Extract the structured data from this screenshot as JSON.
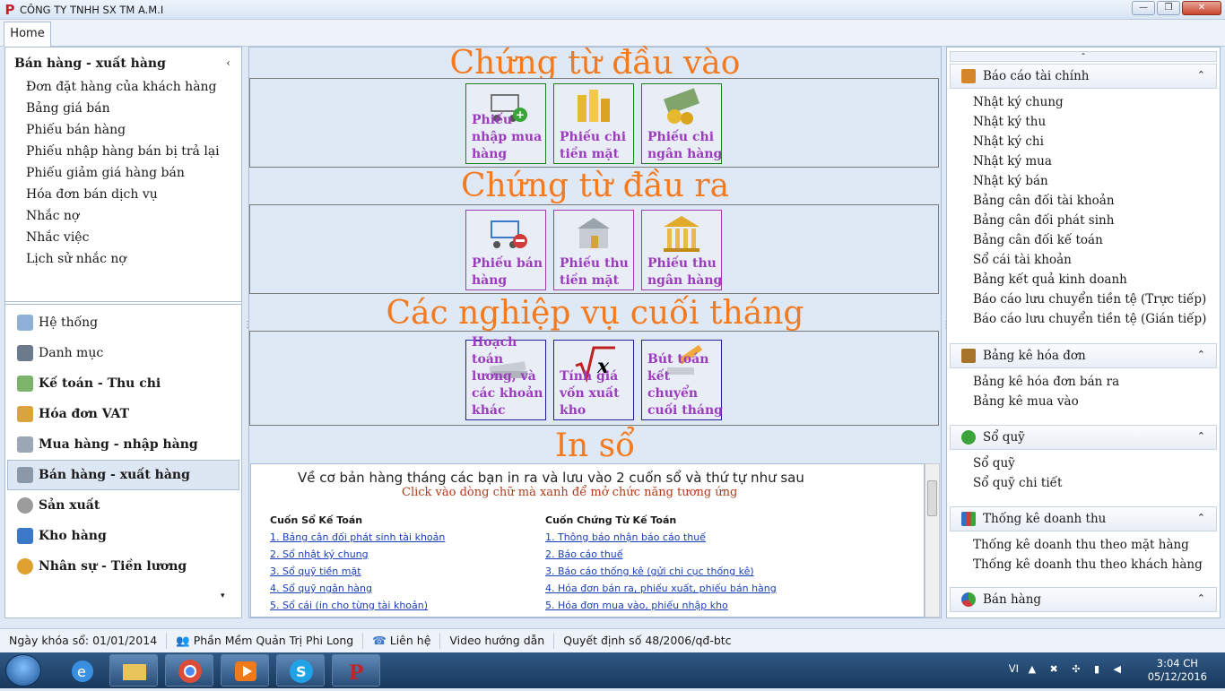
{
  "window": {
    "title": "CÔNG TY TNHH SX TM A.M.I",
    "logo_letter": "P"
  },
  "ribbon": {
    "tab_home": "Home"
  },
  "left": {
    "group_title": "Bán hàng - xuất hàng",
    "collapse_glyph": "‹",
    "items": [
      "Đơn đặt hàng của khách hàng",
      "Bảng giá bán",
      "Phiếu bán hàng",
      "Phiếu nhập hàng bán bị trả lại",
      "Phiếu giảm giá hàng bán",
      "Hóa đơn bán dịch vụ",
      "Nhắc nợ",
      "Nhắc việc",
      "Lịch sử nhắc nợ"
    ],
    "navs": [
      "Hệ thống",
      "Danh mục",
      "Kế toán - Thu chi",
      "Hóa đơn VAT",
      "Mua hàng - nhập hàng",
      "Bán hàng - xuất hàng",
      "Sản xuất",
      "Kho hàng",
      "Nhân sự - Tiền lương"
    ],
    "scroll_glyph": "▾"
  },
  "center": {
    "s1_title": "Chứng từ đầu vào",
    "s1_tiles": [
      "Phiếu nhập mua hàng",
      "Phiếu chi tiền mặt",
      "Phiếu chi ngân hàng"
    ],
    "s2_title": "Chứng từ đầu ra",
    "s2_tiles": [
      "Phiếu bán hàng",
      "Phiếu thu tiền mặt",
      "Phiếu thu ngân hàng"
    ],
    "s3_title": "Các nghiệp vụ cuối tháng",
    "s3_tiles": [
      "Hoạch toán lương, và các khoản khác",
      "Tính giá vốn xuất kho",
      "Bút toán kết chuyển cuối tháng"
    ],
    "s4_title": "In sổ",
    "inso_line1": "Về cơ bản hàng tháng các bạn in ra và lưu vào 2 cuốn sổ và thứ tự như sau",
    "inso_line2": "Click vào dòng chữ mà xanh để mở chức năng tương ứng",
    "col1_header": "Cuốn Sổ Kế Toán",
    "col1_links": [
      "1. Bảng cân đối phát sinh tài khoản",
      "2. Sổ nhật ký chung",
      "3. Sổ quỹ tiền mặt",
      "4. Sổ quỹ ngân hàng",
      "5. Sổ cái (in cho từng tài khoản)"
    ],
    "col2_header": "Cuốn Chứng Từ Kế Toán",
    "col2_links": [
      "1. Thông báo nhận báo cáo thuế",
      "2. Báo cáo thuế",
      "3. Báo cáo thống kê (gửi chi cục thống kê)",
      "4. Hóa đơn bán ra, phiếu xuất, phiếu bán hàng",
      "5. Hóa đơn mua vào, phiếu nhập kho"
    ]
  },
  "right": {
    "top_glyph": "⌃",
    "g1": {
      "title": "Báo cáo tài chính",
      "items": [
        "Nhật ký chung",
        "Nhật ký thu",
        "Nhật ký chi",
        "Nhật ký mua",
        "Nhật ký bán",
        "Bảng cân đối tài khoản",
        "Bảng cân đối phát sinh",
        "Bảng cân đối kế toán",
        "Sổ cái tài khoản",
        "Bảng kết quả kinh doanh",
        "Báo cáo lưu chuyển tiền tệ (Trực tiếp)",
        "Báo cáo lưu chuyển tiền tệ (Gián tiếp)"
      ]
    },
    "g2": {
      "title": "Bảng kê hóa đơn",
      "items": [
        "Bảng kê hóa đơn bán ra",
        "Bảng kê mua vào"
      ]
    },
    "g3": {
      "title": "Sổ quỹ",
      "items": [
        "Sổ quỹ",
        "Sổ quỹ chi tiết"
      ]
    },
    "g4": {
      "title": "Thống kê doanh thu",
      "items": [
        "Thống kê doanh thu theo mặt hàng",
        "Thống kê doanh thu theo khách hàng"
      ]
    },
    "g5": {
      "title": "Bán hàng"
    },
    "chevron": "⌃"
  },
  "status": {
    "lock_date": "Ngày khóa sổ: 01/01/2014",
    "software": "Phần Mềm Quản Trị Phi Long",
    "contact": "Liên hệ",
    "video": "Video hướng dẫn",
    "decision": "Quyết định số 48/2006/qđ-btc"
  },
  "taskbar": {
    "lang": "VI",
    "time": "3:04 CH",
    "date": "05/12/2016"
  }
}
